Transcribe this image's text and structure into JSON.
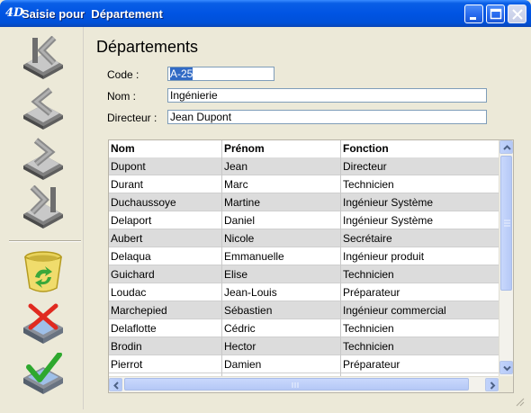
{
  "window": {
    "logo": "4D",
    "title": "Saisie pour  Département",
    "controls": [
      "minimize-icon",
      "maximize-icon",
      "close-icon"
    ]
  },
  "toolbar": {
    "items": [
      {
        "name": "first-record",
        "icon": "first-record-icon"
      },
      {
        "name": "previous-record",
        "icon": "previous-record-icon"
      },
      {
        "name": "next-record",
        "icon": "next-record-icon"
      },
      {
        "name": "last-record",
        "icon": "last-record-icon"
      },
      {
        "name": "delete-record",
        "icon": "recycle-bin-icon"
      },
      {
        "name": "cancel",
        "icon": "cancel-icon"
      },
      {
        "name": "validate",
        "icon": "validate-icon"
      }
    ]
  },
  "form": {
    "title": "Départements",
    "code": {
      "label": "Code :",
      "value": "A-25"
    },
    "nom": {
      "label": "Nom :",
      "value": "Ingénierie"
    },
    "directeur": {
      "label": "Directeur :",
      "value": "Jean Dupont"
    }
  },
  "table": {
    "columns": [
      "Nom",
      "Prénom",
      "Fonction"
    ],
    "rows": [
      [
        "Dupont",
        "Jean",
        "Directeur"
      ],
      [
        "Durant",
        "Marc",
        "Technicien"
      ],
      [
        "Duchaussoye",
        "Martine",
        "Ingénieur Système"
      ],
      [
        "Delaport",
        "Daniel",
        "Ingénieur Système"
      ],
      [
        "Aubert",
        "Nicole",
        "Secrétaire"
      ],
      [
        "Delaqua",
        "Emmanuelle",
        "Ingénieur produit"
      ],
      [
        "Guichard",
        "Elise",
        "Technicien"
      ],
      [
        "Loudac",
        "Jean-Louis",
        "Préparateur"
      ],
      [
        "Marchepied",
        "Sébastien",
        "Ingénieur commercial"
      ],
      [
        "Delaflotte",
        "Cédric",
        "Technicien"
      ],
      [
        "Brodin",
        "Hector",
        "Technicien"
      ],
      [
        "Pierrot",
        "Damien",
        "Préparateur"
      ]
    ]
  },
  "colors": {
    "titlebar": "#0054e3",
    "window_bg": "#ece9d8",
    "row_alt": "#dcdcdc",
    "selection": "#316ac5"
  }
}
